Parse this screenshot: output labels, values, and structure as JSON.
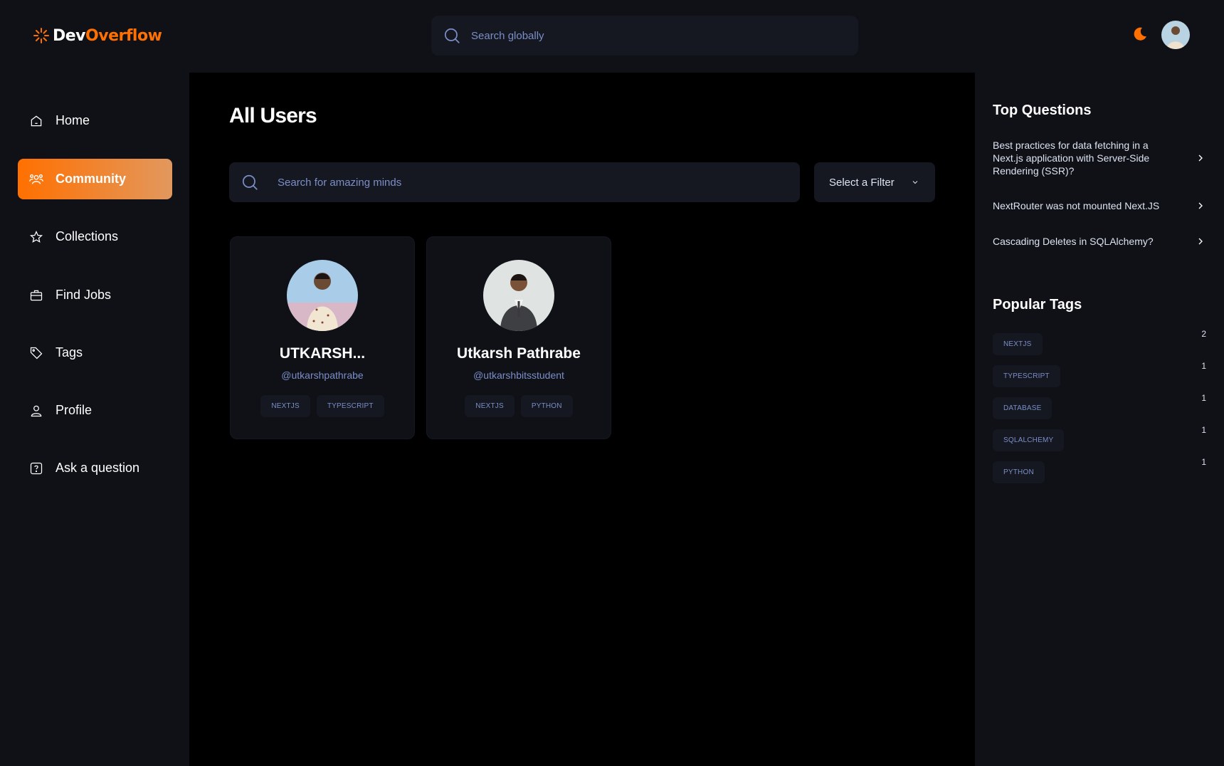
{
  "navbar": {
    "logo_prefix": "Dev",
    "logo_suffix": "Overflow",
    "search_placeholder": "Search globally",
    "theme_icon": "moon-icon",
    "accent_color": "#ff7000"
  },
  "sidebar": {
    "items": [
      {
        "label": "Home",
        "icon": "home-icon",
        "active": false
      },
      {
        "label": "Community",
        "icon": "users-icon",
        "active": true
      },
      {
        "label": "Collections",
        "icon": "star-icon",
        "active": false
      },
      {
        "label": "Find Jobs",
        "icon": "suitcase-icon",
        "active": false
      },
      {
        "label": "Tags",
        "icon": "tag-icon",
        "active": false
      },
      {
        "label": "Profile",
        "icon": "user-icon",
        "active": false
      },
      {
        "label": "Ask a question",
        "icon": "question-icon",
        "active": false
      }
    ]
  },
  "main": {
    "title": "All Users",
    "search_placeholder": "Search for amazing minds",
    "filter_label": "Select a Filter",
    "users": [
      {
        "name": "UTKARSH...",
        "handle": "@utkarshpathrabe",
        "tags": [
          "NEXTJS",
          "TYPESCRIPT"
        ]
      },
      {
        "name": "Utkarsh Pathrabe",
        "handle": "@utkarshbitsstudent",
        "tags": [
          "NEXTJS",
          "PYTHON"
        ]
      }
    ]
  },
  "rightbar": {
    "top_questions_title": "Top Questions",
    "questions": [
      "Best practices for data fetching in a Next.js application with Server-Side Rendering (SSR)?",
      "NextRouter was not mounted Next.JS",
      "Cascading Deletes in SQLAlchemy?"
    ],
    "popular_tags_title": "Popular Tags",
    "popular_tags": [
      {
        "name": "NEXTJS",
        "count": "2"
      },
      {
        "name": "TYPESCRIPT",
        "count": "1"
      },
      {
        "name": "DATABASE",
        "count": "1"
      },
      {
        "name": "SQLALCHEMY",
        "count": "1"
      },
      {
        "name": "PYTHON",
        "count": "1"
      }
    ]
  }
}
